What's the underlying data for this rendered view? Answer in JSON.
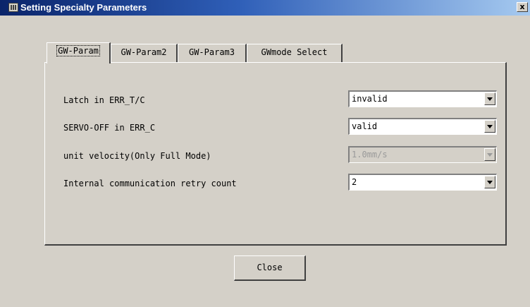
{
  "window": {
    "title": "Setting Specialty Parameters",
    "close_glyph": "x",
    "icon": "app-icon"
  },
  "tabs": [
    {
      "label": "GW-Param",
      "active": true
    },
    {
      "label": "GW-Param2",
      "active": false
    },
    {
      "label": "GW-Param3",
      "active": false
    },
    {
      "label": "GWmode Select",
      "active": false
    }
  ],
  "params": [
    {
      "label": "Latch in ERR_T/C",
      "value": "invalid",
      "enabled": true
    },
    {
      "label": "SERVO-OFF in ERR_C",
      "value": "valid",
      "enabled": true
    },
    {
      "label": "unit velocity(Only Full Mode)",
      "value": "1.0mm/s",
      "enabled": false
    },
    {
      "label": "Internal communication retry count",
      "value": "2",
      "enabled": true
    }
  ],
  "footer": {
    "close_label": "Close"
  },
  "colors": {
    "window_bg": "#d4d0c8",
    "titlebar_start": "#0a246a",
    "titlebar_end": "#a6caf0",
    "disabled_text": "#9a9a9a"
  }
}
